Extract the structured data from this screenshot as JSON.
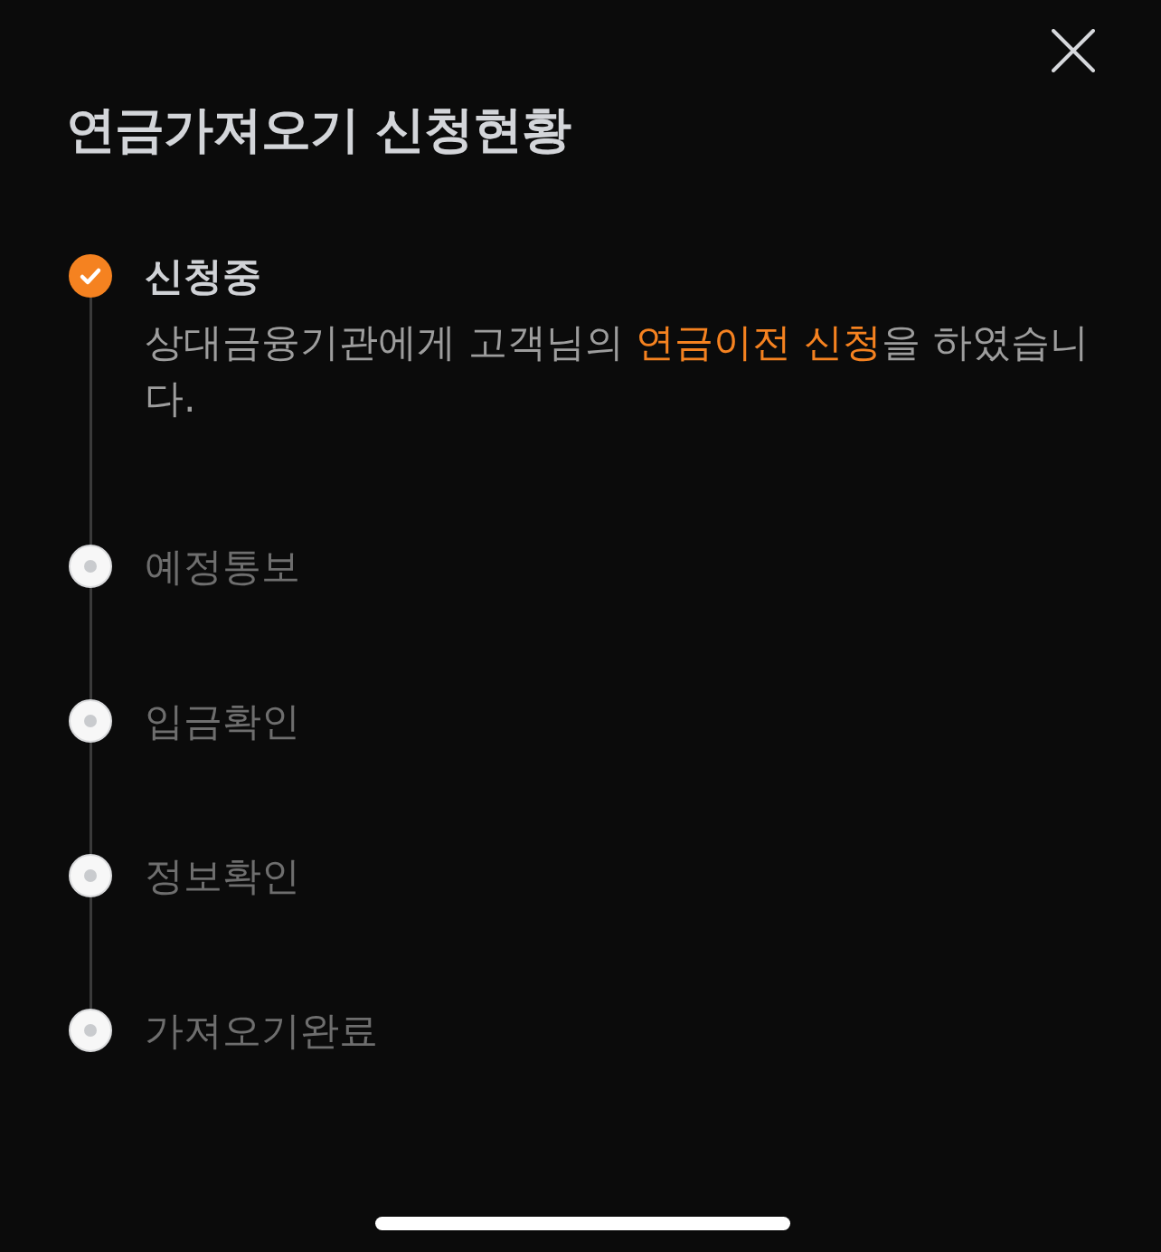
{
  "title": "연금가져오기 신청현황",
  "steps": [
    {
      "label": "신청중",
      "completed": true,
      "description": [
        {
          "text": "상대금융기관에게 고객님의 ",
          "highlight": false
        },
        {
          "text": "연금이전 신청",
          "highlight": true
        },
        {
          "text": "을 하였습니다.",
          "highlight": false
        }
      ]
    },
    {
      "label": "예정통보",
      "completed": false
    },
    {
      "label": "입금확인",
      "completed": false
    },
    {
      "label": "정보확인",
      "completed": false
    },
    {
      "label": "가져오기완료",
      "completed": false
    }
  ]
}
